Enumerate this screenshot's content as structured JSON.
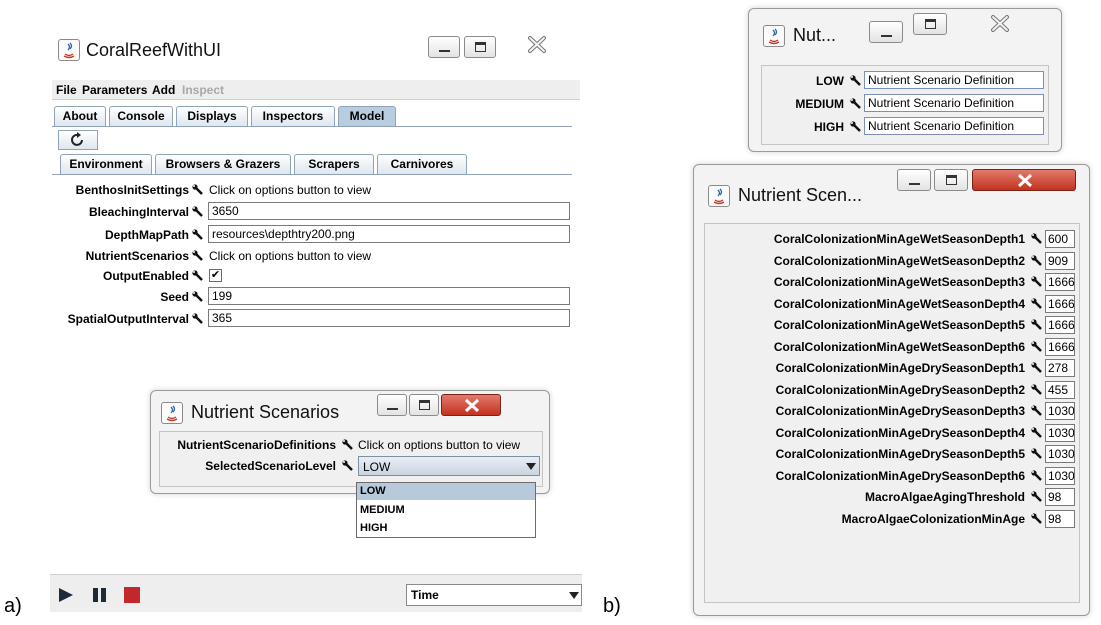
{
  "panel_labels": {
    "a": "a)",
    "b": "b)"
  },
  "main_window": {
    "title": "CoralReefWithUI",
    "menu": [
      "File",
      "Parameters",
      "Add",
      "Inspect"
    ],
    "tabs": [
      "About",
      "Console",
      "Displays",
      "Inspectors",
      "Model"
    ],
    "subtabs": [
      "Environment",
      "Browsers & Grazers",
      "Scrapers",
      "Carnivores"
    ],
    "properties": [
      {
        "label": "BenthosInitSettings",
        "value": "Click on options button to view",
        "kind": "static"
      },
      {
        "label": "BleachingInterval",
        "value": "3650",
        "kind": "field"
      },
      {
        "label": "DepthMapPath",
        "value": "resources\\depthtry200.png",
        "kind": "field"
      },
      {
        "label": "NutrientScenarios",
        "value": "Click on options button to view",
        "kind": "static"
      },
      {
        "label": "OutputEnabled",
        "value": "✔",
        "kind": "checkbox"
      },
      {
        "label": "Seed",
        "value": "199",
        "kind": "field"
      },
      {
        "label": "SpatialOutputInterval",
        "value": "365",
        "kind": "field"
      }
    ],
    "time_select": "Time"
  },
  "nutrient_window": {
    "title": "Nutrient Scenarios",
    "rows": [
      {
        "label": "NutrientScenarioDefinitions",
        "value": "Click on options button to view"
      },
      {
        "label": "SelectedScenarioLevel",
        "value": "LOW"
      }
    ],
    "dropdown_options": [
      "LOW",
      "MEDIUM",
      "HIGH"
    ]
  },
  "nut_small_window": {
    "title": "Nut...",
    "rows": [
      {
        "label": "LOW",
        "value": "Nutrient Scenario Definition"
      },
      {
        "label": "MEDIUM",
        "value": "Nutrient Scenario Definition"
      },
      {
        "label": "HIGH",
        "value": "Nutrient Scenario Definition"
      }
    ]
  },
  "nutrient_scen_window": {
    "title": "Nutrient Scen...",
    "rows": [
      {
        "label": "CoralColonizationMinAgeWetSeasonDepth1",
        "value": "600"
      },
      {
        "label": "CoralColonizationMinAgeWetSeasonDepth2",
        "value": "909"
      },
      {
        "label": "CoralColonizationMinAgeWetSeasonDepth3",
        "value": "1666"
      },
      {
        "label": "CoralColonizationMinAgeWetSeasonDepth4",
        "value": "1666"
      },
      {
        "label": "CoralColonizationMinAgeWetSeasonDepth5",
        "value": "1666"
      },
      {
        "label": "CoralColonizationMinAgeWetSeasonDepth6",
        "value": "1666"
      },
      {
        "label": "CoralColonizationMinAgeDrySeasonDepth1",
        "value": "278"
      },
      {
        "label": "CoralColonizationMinAgeDrySeasonDepth2",
        "value": "455"
      },
      {
        "label": "CoralColonizationMinAgeDrySeasonDepth3",
        "value": "1030"
      },
      {
        "label": "CoralColonizationMinAgeDrySeasonDepth4",
        "value": "1030"
      },
      {
        "label": "CoralColonizationMinAgeDrySeasonDepth5",
        "value": "1030"
      },
      {
        "label": "CoralColonizationMinAgeDrySeasonDepth6",
        "value": "1030"
      },
      {
        "label": "MacroAlgaeAgingThreshold",
        "value": "98"
      },
      {
        "label": "MacroAlgaeColonizationMinAge",
        "value": "98"
      }
    ]
  }
}
